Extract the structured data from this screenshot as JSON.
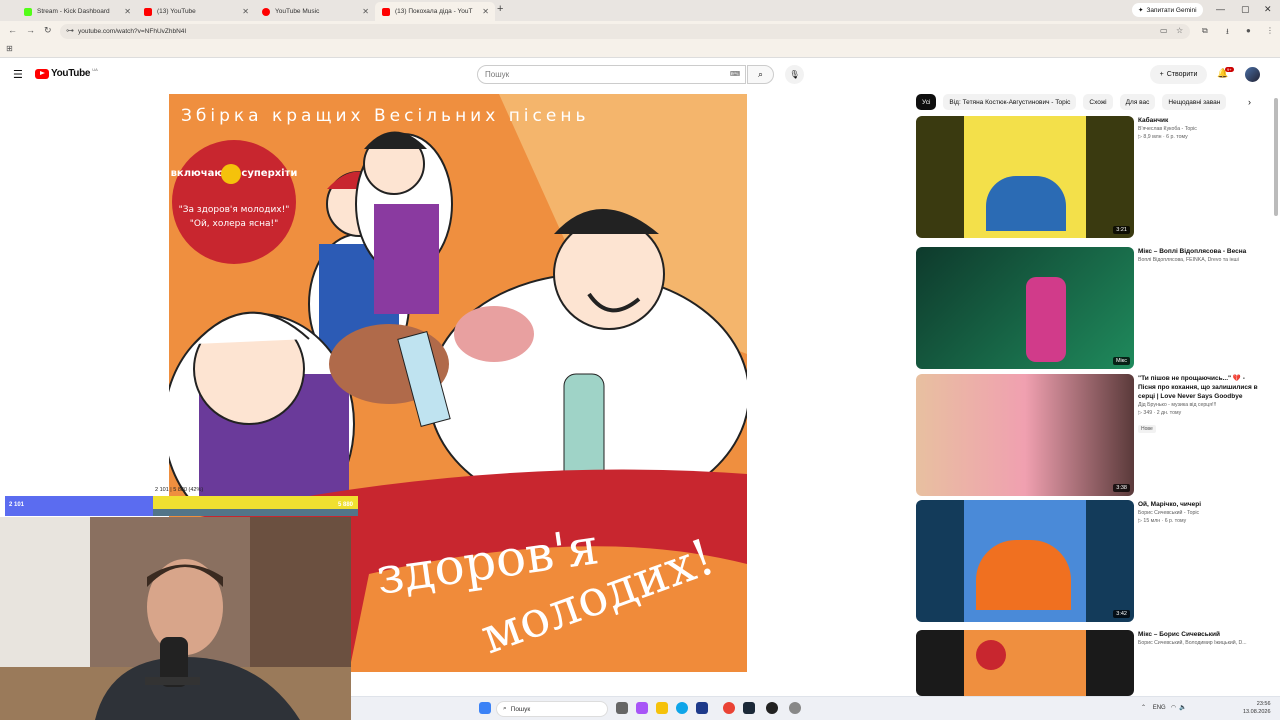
{
  "browser": {
    "tabs": [
      {
        "title": "Stream - Kick Dashboard",
        "favicon_color": "#53fc18"
      },
      {
        "title": "(13) YouTube",
        "favicon_color": "#ff0000"
      },
      {
        "title": "YouTube Music",
        "favicon_color": "#ff0000"
      },
      {
        "title": "(13) Покохала діда - YouT",
        "favicon_color": "#ff0000"
      }
    ],
    "new_tab": "+",
    "gemini_label": "Запитати Gemini",
    "url": "youtube.com/watch?v=NFhUvZhbN4I"
  },
  "youtube": {
    "country": "UA",
    "logo_text": "YouTube",
    "search_placeholder": "Пошук",
    "create_label": "Створити",
    "notifications": "9+"
  },
  "filters": [
    "Усі",
    "Від: Тетяна Костюк-Августинович - Topic",
    "Схожі",
    "Для вас",
    "Нещодавні заван"
  ],
  "recommendations": [
    {
      "title": "Кабанчик",
      "channel": "В'ячеслав Кукоба - Topic",
      "meta": "▷ 8,9 млн · 6 р. тому",
      "duration": "3:21",
      "thumb": [
        "#3a3a10",
        "#f3e04a",
        "#2b6bb4"
      ]
    },
    {
      "title": "Мікс – Воплі Відоплясова - Весна",
      "channel": "Воплі Відоплясова, FEINKA, Drevo та інші",
      "meta": "",
      "duration": "Мікс",
      "thumb": [
        "#0e3a2c",
        "#1f8a5c",
        "#d13b8a"
      ]
    },
    {
      "title": "\"Ти пішов не прощаючись...\" 💔 - Пісня про кохання, що залишилися в серці | Love Never Says Goodbye",
      "channel": "Дід Брунько - музика від серця!!!",
      "meta": "▷ 349 · 2 дн. тому",
      "badge": "Нове",
      "duration": "3:38",
      "thumb": [
        "#5a3a3a",
        "#f0a0b0",
        "#e8c0a0"
      ]
    },
    {
      "title": "Ой, Марічко, чичері",
      "channel": "Борис Сичевський - Topic",
      "meta": "▷ 15 млн · 6 р. тому",
      "duration": "3:42",
      "thumb": [
        "#133b5a",
        "#4a8ad8",
        "#f07020"
      ]
    },
    {
      "title": "Мікс – Борис Сичевський",
      "channel": "Борис Сичевський, Володимир Іжицький, D...",
      "meta": "",
      "duration": "",
      "thumb": [
        "#1a1a1a",
        "#ef8f3f",
        "#c8262f"
      ]
    }
  ],
  "video": {
    "header": "Збірка кращих Весільних пісень",
    "badge_line1": "включаючи суперхіти",
    "badge_line2": "\"За здоров'я молодих!\"",
    "badge_line3": "\"Ой, холера ясна!\"",
    "banner_line1": "здоров'я",
    "banner_line2": "молодих!"
  },
  "stream_overlay": {
    "top_label": "2 101 | 5 880 (42%)",
    "left_value": "2 101",
    "right_value": "5 880",
    "progress": 0.42
  },
  "taskbar": {
    "search_placeholder": "Пошук",
    "lang": "ENG",
    "time": "23:56",
    "date": "13.08.2026"
  }
}
